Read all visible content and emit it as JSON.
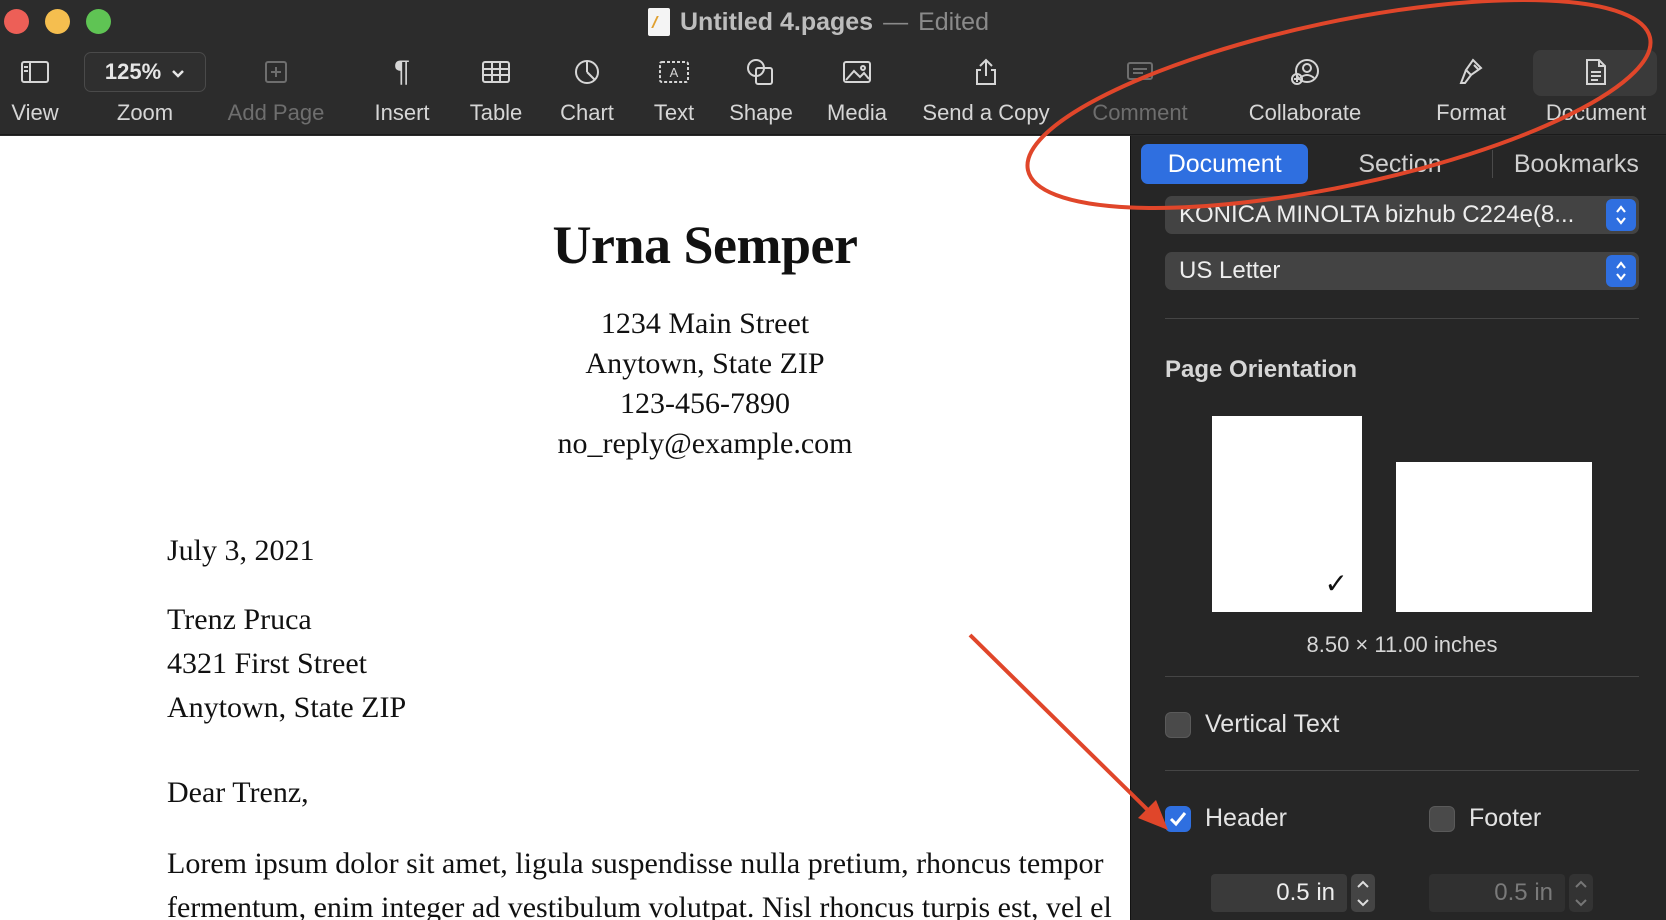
{
  "window": {
    "title": "Untitled 4.pages",
    "separator": "—",
    "state": "Edited"
  },
  "toolbar": {
    "view": "View",
    "zoom_value": "125%",
    "zoom": "Zoom",
    "add_page": "Add Page",
    "insert": "Insert",
    "table": "Table",
    "chart": "Chart",
    "text": "Text",
    "shape": "Shape",
    "media": "Media",
    "send_copy": "Send a Copy",
    "comment": "Comment",
    "collaborate": "Collaborate",
    "format": "Format",
    "document": "Document"
  },
  "document": {
    "title": "Urna Semper",
    "address": [
      "1234 Main Street",
      "Anytown, State ZIP",
      "123-456-7890",
      "no_reply@example.com"
    ],
    "date": "July 3, 2021",
    "recipient": [
      "Trenz Pruca",
      "4321 First Street",
      "Anytown, State ZIP"
    ],
    "greeting": "Dear Trenz,",
    "paragraph": [
      "Lorem ipsum dolor sit amet, ligula suspendisse nulla pretium, rhoncus tempor",
      "fermentum, enim integer ad vestibulum volutpat. Nisl rhoncus turpis est, vel el"
    ]
  },
  "sidebar": {
    "tabs": {
      "document": "Document",
      "section": "Section",
      "bookmarks": "Bookmarks"
    },
    "printer": "KONICA MINOLTA bizhub C224e(8...",
    "paper_size": "US Letter",
    "orientation_label": "Page Orientation",
    "dimensions": "8.50 × 11.00 inches",
    "vertical_text": {
      "label": "Vertical Text",
      "checked": false
    },
    "header": {
      "label": "Header",
      "checked": true,
      "value": "0.5 in"
    },
    "footer": {
      "label": "Footer",
      "checked": false,
      "value": "0.5 in"
    }
  },
  "colors": {
    "accent": "#2f6fe0",
    "annotation": "#e0462a",
    "toolbar_bg": "#2c2c2c",
    "sidebar_bg": "#262626"
  }
}
